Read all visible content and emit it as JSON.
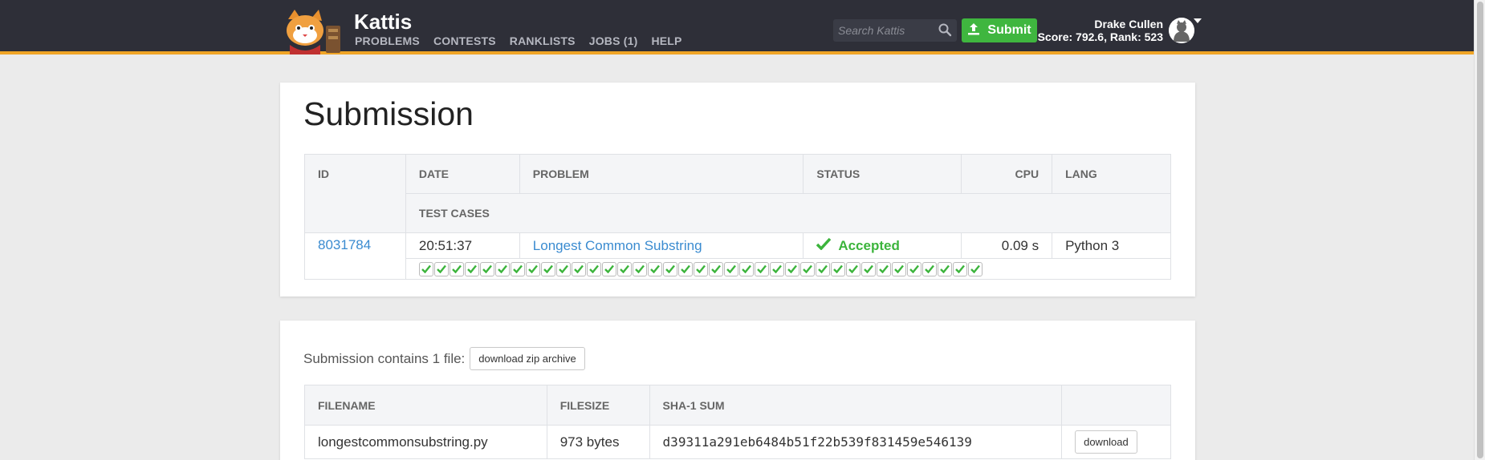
{
  "header": {
    "brand": "Kattis",
    "nav": [
      "PROBLEMS",
      "CONTESTS",
      "RANKLISTS",
      "JOBS (1)",
      "HELP"
    ],
    "search_placeholder": "Search Kattis",
    "submit_label": "Submit",
    "user_name": "Drake Cullen",
    "user_score": "Score: 792.6, Rank: 523"
  },
  "submission": {
    "title": "Submission",
    "headers": {
      "id": "ID",
      "date": "DATE",
      "problem": "PROBLEM",
      "status": "STATUS",
      "cpu": "CPU",
      "lang": "LANG",
      "test_cases": "TEST CASES"
    },
    "row": {
      "id": "8031784",
      "date": "20:51:37",
      "problem": "Longest Common Substring",
      "status": "Accepted",
      "cpu": "0.09 s",
      "lang": "Python 3"
    },
    "test_cases_passed": 37
  },
  "files": {
    "label": "Submission contains 1 file:",
    "download_zip_label": "download zip archive",
    "headers": {
      "filename": "FILENAME",
      "filesize": "FILESIZE",
      "sha1": "SHA-1 SUM"
    },
    "rows": [
      {
        "filename": "longestcommonsubstring.py",
        "filesize": "973 bytes",
        "sha1": "d39311a291eb6484b51f22b539f831459e546139",
        "download_label": "download"
      }
    ]
  },
  "colors": {
    "topbar": "#2e2f38",
    "accent": "#f0a526",
    "submit_green": "#3fb63f",
    "accepted_green": "#3cb43c",
    "link": "#3a8bd0"
  }
}
